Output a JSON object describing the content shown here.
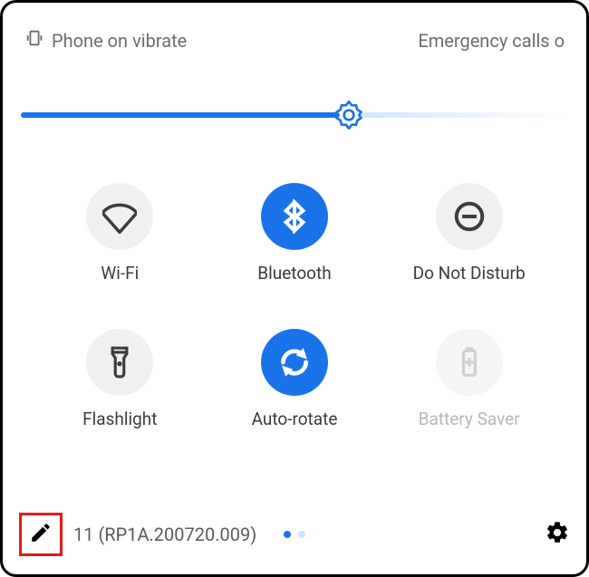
{
  "status": {
    "vibrate_text": "Phone on vibrate",
    "emergency_text": "Emergency calls o"
  },
  "slider": {
    "percent": 60
  },
  "tiles": [
    {
      "key": "wifi",
      "label": "Wi-Fi",
      "state": "off"
    },
    {
      "key": "bluetooth",
      "label": "Bluetooth",
      "state": "on"
    },
    {
      "key": "dnd",
      "label": "Do Not Disturb",
      "state": "off"
    },
    {
      "key": "flashlight",
      "label": "Flashlight",
      "state": "off"
    },
    {
      "key": "autorotate",
      "label": "Auto-rotate",
      "state": "on"
    },
    {
      "key": "battery",
      "label": "Battery Saver",
      "state": "disabled"
    }
  ],
  "footer": {
    "build": "11 (RP1A.200720.009)",
    "pages": 2,
    "current_page": 0
  },
  "colors": {
    "accent": "#1a73e8",
    "highlight_box": "#e21b1b"
  }
}
